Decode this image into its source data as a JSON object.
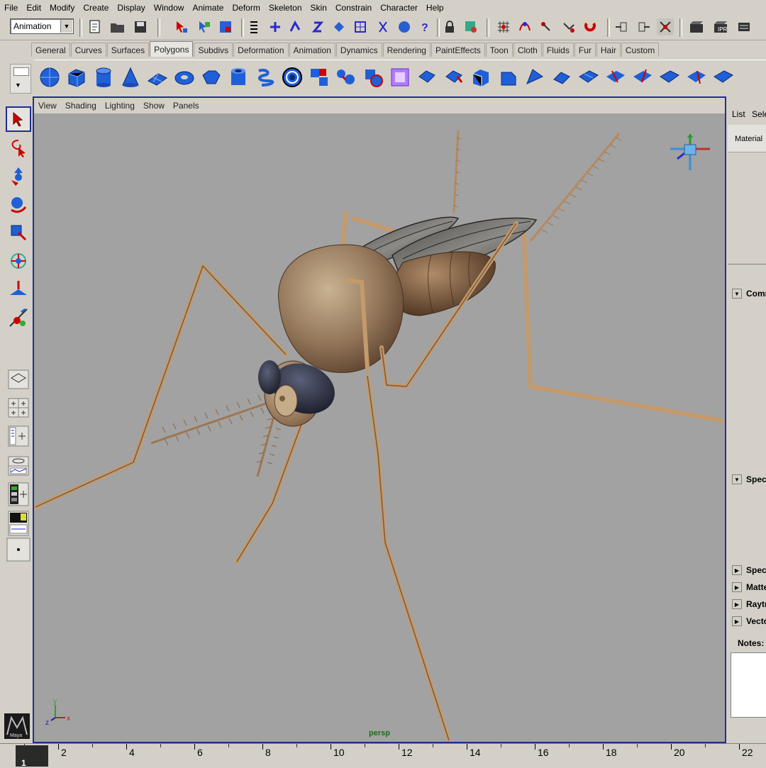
{
  "menu": [
    "File",
    "Edit",
    "Modify",
    "Create",
    "Display",
    "Window",
    "Animate",
    "Deform",
    "Skeleton",
    "Skin",
    "Constrain",
    "Character",
    "Help"
  ],
  "status_line": {
    "mode": "Animation"
  },
  "shelf_tabs": [
    "General",
    "Curves",
    "Surfaces",
    "Polygons",
    "Subdivs",
    "Deformation",
    "Animation",
    "Dynamics",
    "Rendering",
    "PaintEffects",
    "Toon",
    "Cloth",
    "Fluids",
    "Fur",
    "Hair",
    "Custom"
  ],
  "active_shelf_tab": "Polygons",
  "panel_menu": [
    "View",
    "Shading",
    "Lighting",
    "Show",
    "Panels"
  ],
  "viewport": {
    "camera": "persp",
    "axis_labels": {
      "y": "y",
      "z": "z",
      "x": "x"
    }
  },
  "right_panel": {
    "tabs": [
      "List",
      "Selected"
    ],
    "material_tab": "Material",
    "sections": [
      "Common",
      "Specular",
      "Special",
      "Matte",
      "Raytrace",
      "Vector"
    ],
    "notes": "Notes:"
  },
  "timeline": {
    "current_frame": "1",
    "tick_labels": [
      "2",
      "4",
      "6",
      "8",
      "10",
      "12",
      "14",
      "16",
      "18",
      "20",
      "22"
    ]
  },
  "logo": "Maya",
  "colors": {
    "viewport_bg": "#a2a2a2",
    "ui_bg": "#d4d0c8",
    "active_frame": "#1f2f8f",
    "camera_label": "#1c6e1c",
    "insect": "#c49a6c"
  }
}
